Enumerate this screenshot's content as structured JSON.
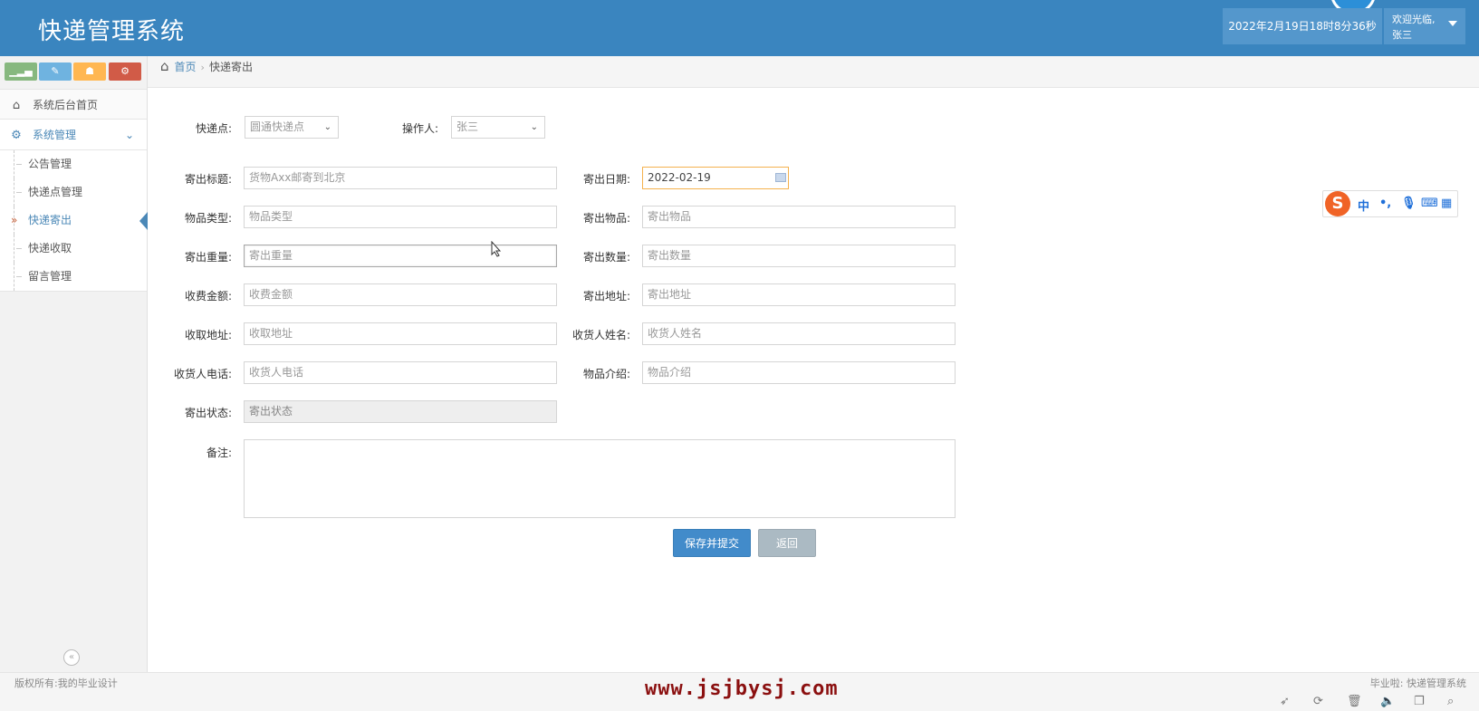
{
  "header": {
    "app_title": "快递管理系统",
    "datetime": "2022年2月19日18时8分36秒",
    "welcome": "欢迎光临,",
    "username": "张三"
  },
  "sidebar": {
    "shortcut_icons": [
      "signal-icon",
      "pencil-icon",
      "users-icon",
      "cogs-icon"
    ],
    "home_item": "系统后台首页",
    "group_label": "系统管理",
    "items": [
      {
        "label": "公告管理",
        "active": false
      },
      {
        "label": "快递点管理",
        "active": false
      },
      {
        "label": "快递寄出",
        "active": true
      },
      {
        "label": "快递收取",
        "active": false
      },
      {
        "label": "留言管理",
        "active": false
      }
    ],
    "collapse_icon": "double-chevron-left-icon"
  },
  "breadcrumb": {
    "home": "首页",
    "current": "快递寄出"
  },
  "form": {
    "express_point_label": "快递点:",
    "express_point_value": "圆通快递点",
    "operator_label": "操作人:",
    "operator_value": "张三",
    "title_label": "寄出标题:",
    "title_value": "货物Axx邮寄到北京",
    "date_label": "寄出日期:",
    "date_value": "2022-02-19",
    "type_label": "物品类型:",
    "type_placeholder": "物品类型",
    "item_label": "寄出物品:",
    "item_placeholder": "寄出物品",
    "weight_label": "寄出重量:",
    "weight_placeholder": "寄出重量",
    "qty_label": "寄出数量:",
    "qty_placeholder": "寄出数量",
    "fee_label": "收费金额:",
    "fee_placeholder": "收费金额",
    "send_addr_label": "寄出地址:",
    "send_addr_placeholder": "寄出地址",
    "recv_addr_label": "收取地址:",
    "recv_addr_placeholder": "收取地址",
    "recv_name_label": "收货人姓名:",
    "recv_name_placeholder": "收货人姓名",
    "recv_phone_label": "收货人电话:",
    "recv_phone_placeholder": "收货人电话",
    "intro_label": "物品介绍:",
    "intro_placeholder": "物品介绍",
    "status_label": "寄出状态:",
    "status_placeholder": "寄出状态",
    "remark_label": "备注:",
    "save_button": "保存并提交",
    "back_button": "返回"
  },
  "ime": {
    "logo": "S",
    "mode": "中",
    "punct": "•,",
    "items": [
      "mic-icon",
      "keyboard-icon",
      "grid-icon"
    ]
  },
  "footer": {
    "copyright": "版权所有:我的毕业设计",
    "right_text": "毕业啦: 快递管理系统",
    "watermark": "www.jsjbysj.com",
    "tray_icons": [
      "rocket-icon",
      "refresh-icon",
      "trash-icon",
      "volume-icon",
      "copy-icon",
      "search-icon"
    ]
  },
  "colors": {
    "header_bg": "#3a85bf",
    "accent_blue": "#428bca",
    "active_arrow": "#4b88b7",
    "date_border": "#f5b24e",
    "watermark": "#8b1010"
  }
}
